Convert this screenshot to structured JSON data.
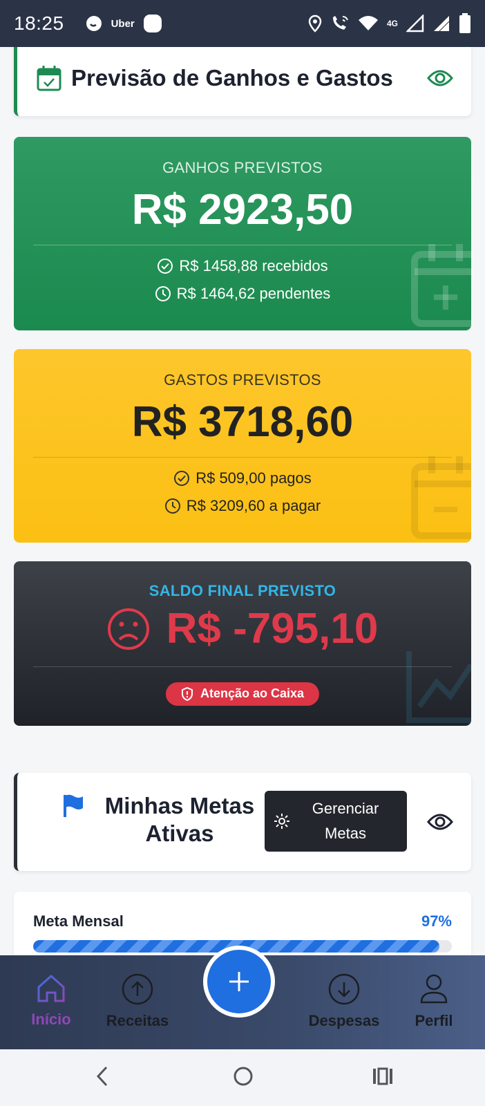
{
  "status_bar": {
    "time": "18:25",
    "notification_app": "Uber",
    "network": "4G",
    "icons": [
      "whatsapp-icon",
      "uber-icon",
      "app-icon",
      "location-icon",
      "wifi-call-icon",
      "wifi-icon",
      "signal-icon",
      "signal-icon",
      "battery-icon"
    ]
  },
  "forecast_header": {
    "title": "Previsão de Ganhos e Gastos",
    "icon": "calendar-check-icon",
    "visibility_icon": "eye-icon"
  },
  "income_card": {
    "label": "GANHOS PREVISTOS",
    "amount": "R$ 2923,50",
    "received": "R$ 1458,88 recebidos",
    "pending": "R$ 1464,62 pendentes",
    "color": "#1e8a52"
  },
  "expense_card": {
    "label": "GASTOS PREVISTOS",
    "amount": "R$ 3718,60",
    "paid": "R$ 509,00 pagos",
    "to_pay": "R$ 3209,60 a pagar",
    "color": "#fcc013"
  },
  "balance_card": {
    "label": "SALDO FINAL PREVISTO",
    "amount": "R$ -795,10",
    "status_icon": "sad-face-icon",
    "alert": "Atenção ao Caixa",
    "amount_color": "#df3a4b"
  },
  "goals_header": {
    "title": "Minhas Metas Ativas",
    "icon": "flag-icon",
    "manage_button": "Gerenciar Metas",
    "visibility_icon": "eye-icon"
  },
  "goals": [
    {
      "name": "Meta Mensal",
      "percent_label": "97%",
      "progress": 0.97
    }
  ],
  "bottom_nav": {
    "items": [
      {
        "label": "Início",
        "icon": "home-icon",
        "active": true
      },
      {
        "label": "Receitas",
        "icon": "arrow-up-circle-icon",
        "active": false
      },
      {
        "label": "Despesas",
        "icon": "arrow-down-circle-icon",
        "active": false
      },
      {
        "label": "Perfil",
        "icon": "person-icon",
        "active": false
      }
    ],
    "fab_icon": "plus-icon"
  },
  "system_nav": [
    "back-icon",
    "home-circle-icon",
    "recents-icon"
  ]
}
